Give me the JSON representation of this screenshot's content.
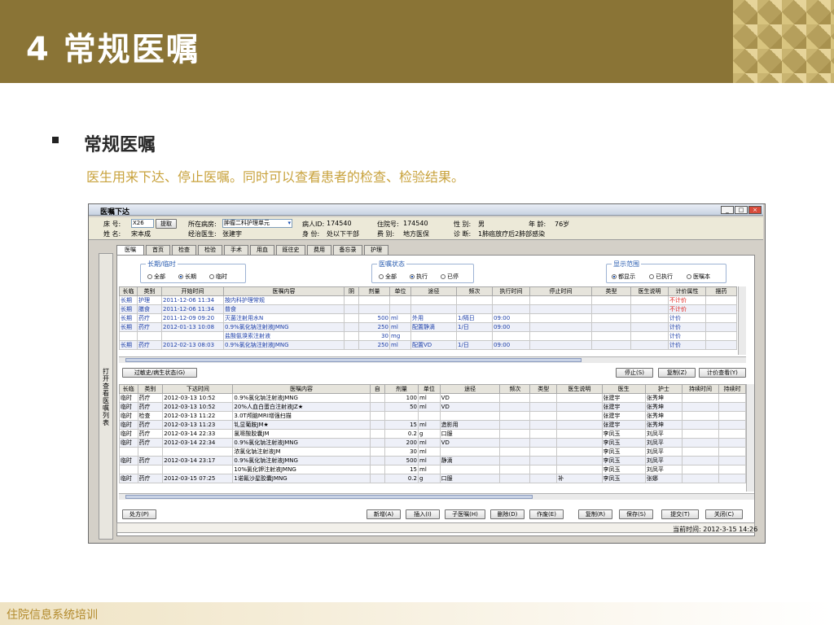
{
  "slide": {
    "title": "4 常规医嘱",
    "heading": "常规医嘱",
    "description": "医生用来下达、停止医嘱。同时可以查看患者的检查、检验结果。",
    "footer": "住院信息系统培训"
  },
  "window": {
    "title": "医嘱下达",
    "btn_min": "_",
    "btn_max": "□",
    "btn_close": "×"
  },
  "patient": {
    "bed_label": "床 号:",
    "bed_value": "X26",
    "fetch_button": "提取",
    "ward_label": "所在病房:",
    "ward_value": "肿瘤二科护理单元",
    "pid_label": "病人ID:",
    "pid_value": "174540",
    "inpatient_label": "住院号:",
    "inpatient_value": "174540",
    "sex_label": "性 别:",
    "sex_value": "男",
    "age_label": "年 龄:",
    "age_value": "76岁",
    "name_label": "姓 名:",
    "name_value": "宋本成",
    "doctor_label": "经治医生:",
    "doctor_value": "张建宇",
    "identity_label": "身 份:",
    "identity_value": "处以下干部",
    "fee_label": "费 别:",
    "fee_value": "地方医保",
    "diagnosis_label": "诊 断:",
    "diagnosis_value": "1肺癌放疗后2肺部感染"
  },
  "tabs": [
    "医嘱",
    "首页",
    "检查",
    "检验",
    "手术",
    "用血",
    "既往史",
    "费用",
    "备忘录",
    "护理"
  ],
  "side_label": "打开查看医嘱列表",
  "filters": {
    "term": {
      "title": "长期/临时",
      "options": [
        "全部",
        "长期",
        "临时"
      ],
      "selected": "长期"
    },
    "status": {
      "title": "医嘱状态",
      "options": [
        "全部",
        "执行",
        "已停"
      ],
      "selected": "执行"
    },
    "scope": {
      "title": "显示范围",
      "options": [
        "都显示",
        "已执行",
        "医嘱本"
      ],
      "selected": "都显示"
    }
  },
  "upper_table": {
    "columns": [
      "长临",
      "类别",
      "开始时间",
      "医嘱内容",
      "阴",
      "剂量",
      "单位",
      "途径",
      "频次",
      "执行时间",
      "停止时间",
      "类型",
      "医生说明",
      "计价属性",
      "摆药"
    ],
    "rows": [
      [
        "长期",
        "护理",
        "2011-12-06 11:34",
        "按内科护理常规",
        "",
        "",
        "",
        "",
        "",
        "",
        "",
        "",
        "",
        "不计价",
        ""
      ],
      [
        "长期",
        "膳食",
        "2011-12-06 11:34",
        "普食",
        "",
        "",
        "",
        "",
        "",
        "",
        "",
        "",
        "",
        "不计价",
        ""
      ],
      [
        "长期",
        "药疗",
        "2011-12-09 09:20",
        "灭菌注射用水N",
        "",
        "500",
        "ml",
        "外用",
        "1/隔日",
        "09:00",
        "",
        "",
        "",
        "计价",
        ""
      ],
      [
        "长期",
        "药疗",
        "2012-01-13 10:08",
        "0.9%氯化钠注射液JMNG",
        "",
        "250",
        "ml",
        "配置静滴",
        "1/日",
        "09:00",
        "",
        "",
        "",
        "计价",
        ""
      ],
      [
        "",
        "",
        "",
        "盐酸氨溴索注射液",
        "",
        "30",
        "mg",
        "",
        "",
        "",
        "",
        "",
        "",
        "计价",
        ""
      ],
      [
        "长期",
        "药疗",
        "2012-02-13 08:03",
        "0.9%氯化钠注射液JMNG",
        "",
        "250",
        "ml",
        "配置VD",
        "1/日",
        "09:00",
        "",
        "",
        "",
        "计价",
        ""
      ]
    ]
  },
  "upper_buttons": {
    "allergy": "过敏史/病生状态(G)",
    "stop": "停止(S)",
    "copy": "复制(Z)",
    "price": "计价查看(Y)"
  },
  "lower_table": {
    "columns": [
      "长临",
      "类别",
      "下达时间",
      "医嘱内容",
      "自",
      "剂量",
      "单位",
      "途径",
      "频次",
      "类型",
      "医生说明",
      "医生",
      "护士",
      "持续时间",
      "持续时"
    ],
    "rows": [
      [
        "临时",
        "药疗",
        "2012-03-13 10:52",
        "0.9%氯化钠注射液JMNG",
        "",
        "100",
        "ml",
        "VD",
        "",
        "",
        "",
        "张建宇",
        "张秀坤",
        "",
        ""
      ],
      [
        "临时",
        "药疗",
        "2012-03-13 10:52",
        "20%人血白蛋白注射液JZ★",
        "",
        "50",
        "ml",
        "VD",
        "",
        "",
        "",
        "张建宇",
        "张秀坤",
        "",
        ""
      ],
      [
        "临时",
        "检查",
        "2012-03-13 11:22",
        "3.0T颅脑MRI增强扫描",
        "",
        "",
        "",
        "",
        "",
        "",
        "",
        "张建宇",
        "张秀坤",
        "",
        ""
      ],
      [
        "临时",
        "药疗",
        "2012-03-13 11:23",
        "钆显葡胺JM★",
        "",
        "15",
        "ml",
        "造影用",
        "",
        "",
        "",
        "张建宇",
        "张秀坤",
        "",
        ""
      ],
      [
        "临时",
        "药疗",
        "2012-03-14 22:33",
        "氯哌酸胶囊JM",
        "",
        "0.2",
        "g",
        "口服",
        "",
        "",
        "",
        "李凤玉",
        "刘凤平",
        "",
        ""
      ],
      [
        "临时",
        "药疗",
        "2012-03-14 22:34",
        "0.9%氯化钠注射液JMNG",
        "",
        "200",
        "ml",
        "VD",
        "",
        "",
        "",
        "李凤玉",
        "刘凤平",
        "",
        ""
      ],
      [
        "",
        "",
        "",
        "浓氯化钠注射液JM",
        "",
        "30",
        "ml",
        "",
        "",
        "",
        "",
        "李凤玉",
        "刘凤平",
        "",
        ""
      ],
      [
        "临时",
        "药疗",
        "2012-03-14 23:17",
        "0.9%氯化钠注射液JMNG",
        "",
        "500",
        "ml",
        "静滴",
        "",
        "",
        "",
        "李凤玉",
        "刘凤平",
        "",
        ""
      ],
      [
        "",
        "",
        "",
        "10%氯化钾注射液JMNG",
        "",
        "15",
        "ml",
        "",
        "",
        "",
        "",
        "李凤玉",
        "刘凤平",
        "",
        ""
      ],
      [
        "临时",
        "药疗",
        "2012-03-15 07:25",
        "1诺氟沙星胶囊JMNG",
        "",
        "0.2",
        "g",
        "口服",
        "",
        "",
        "补",
        "李凤玉",
        "张娜",
        "",
        ""
      ]
    ]
  },
  "bottom_buttons": {
    "prescription": "处方(P)",
    "add": "新增(A)",
    "insert": "插入(I)",
    "child": "子医嘱(H)",
    "delete": "删除(D)",
    "void": "作废(E)",
    "copy": "复制(R)",
    "save": "保存(S)",
    "submit": "提交(T)",
    "close": "关闭(C)"
  },
  "status": {
    "current_time": "当前时间: 2012-3-15 14:26"
  },
  "colors": {
    "banner": "#8a7436",
    "accent_text": "#c8a23c",
    "order_text_blue": "#1d3fa8",
    "no_charge_red": "#e0201a"
  }
}
